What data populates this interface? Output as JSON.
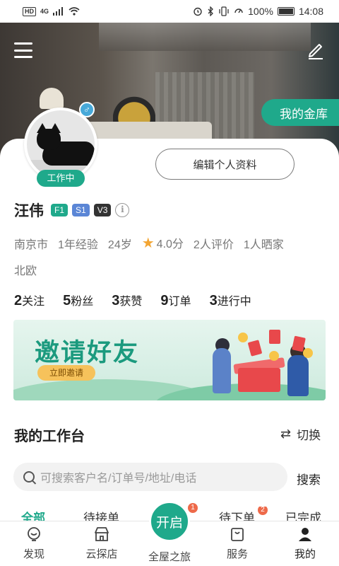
{
  "status_bar": {
    "network_label": "HD",
    "signal_label": "4G",
    "battery_percent": "100%",
    "time": "14:08"
  },
  "header": {
    "menu_icon": "menu-icon",
    "edit_icon": "pencil-icon",
    "vault_button": "我的金库"
  },
  "profile": {
    "status": "工作中",
    "gender_icon": "male-icon",
    "edit_profile_button": "编辑个人资料",
    "name": "汪伟",
    "tags": [
      "F1",
      "S1",
      "V3"
    ],
    "meta": {
      "city": "南京市",
      "experience": "1年经验",
      "age": "24岁",
      "rating": "4.0分",
      "reviews": "2人评价",
      "showcase": "1人晒家"
    },
    "style": "北欧",
    "stats": [
      {
        "num": "2",
        "label": "关注"
      },
      {
        "num": "5",
        "label": "粉丝"
      },
      {
        "num": "3",
        "label": "获赞"
      },
      {
        "num": "9",
        "label": "订单"
      },
      {
        "num": "3",
        "label": "进行中"
      }
    ]
  },
  "banner": {
    "title": "邀请好友",
    "button": "立即邀请"
  },
  "workbench": {
    "title": "我的工作台",
    "switch_label": "切换",
    "search_placeholder": "可搜索客户名/订单号/地址/电话",
    "search_button": "搜索",
    "tabs": [
      {
        "label": "全部",
        "badge": ""
      },
      {
        "label": "待接单",
        "badge": ""
      },
      {
        "label": "待下单",
        "badge": "2"
      },
      {
        "label": "已完成",
        "badge": ""
      }
    ]
  },
  "bottom_nav": {
    "items": [
      {
        "label": "发现",
        "icon": "discover-icon"
      },
      {
        "label": "云探店",
        "icon": "store-icon"
      },
      {
        "label": "全屋之旅",
        "icon": ""
      },
      {
        "label": "服务",
        "icon": "bag-icon"
      },
      {
        "label": "我的",
        "icon": "user-icon"
      }
    ],
    "center_button": "开启",
    "center_badge": "1"
  },
  "colors": {
    "accent": "#1fa98b",
    "badge": "#ee6a4a",
    "star": "#f3a532"
  }
}
